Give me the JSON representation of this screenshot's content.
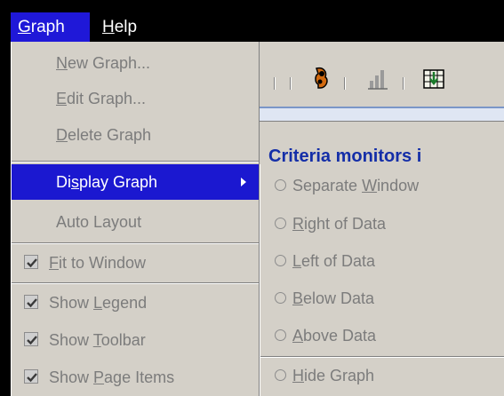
{
  "menubar": {
    "graph": {
      "pre": "",
      "key": "G",
      "post": "raph"
    },
    "help": {
      "pre": "",
      "key": "H",
      "post": "elp"
    }
  },
  "background": {
    "heading": "Criteria monitors i"
  },
  "graph_menu": {
    "new_graph": {
      "pre": "",
      "key": "N",
      "post": "ew Graph..."
    },
    "edit_graph": {
      "pre": "",
      "key": "E",
      "post": "dit Graph..."
    },
    "delete_graph": {
      "pre": "",
      "key": "D",
      "post": "elete Graph"
    },
    "display_graph": {
      "pre": "Di",
      "key": "s",
      "post": "play Graph"
    },
    "auto_layout": {
      "pre": "Auto Layout",
      "key": "",
      "post": ""
    },
    "fit_to_window": {
      "pre": "",
      "key": "F",
      "post": "it to Window",
      "checked": true
    },
    "show_legend": {
      "pre": "Show ",
      "key": "L",
      "post": "egend",
      "checked": true
    },
    "show_toolbar": {
      "pre": "Show ",
      "key": "T",
      "post": "oolbar",
      "checked": true
    },
    "show_page_items": {
      "pre": "Show ",
      "key": "P",
      "post": "age Items",
      "checked": true
    }
  },
  "display_submenu": {
    "separate_window": {
      "pre": "Separate ",
      "key": "W",
      "post": "indow"
    },
    "right_of_data": {
      "pre": "",
      "key": "R",
      "post": "ight of Data"
    },
    "left_of_data": {
      "pre": "",
      "key": "L",
      "post": "eft of Data"
    },
    "below_data": {
      "pre": "",
      "key": "B",
      "post": "elow Data"
    },
    "above_data": {
      "pre": "",
      "key": "A",
      "post": "bove Data"
    },
    "hide_graph": {
      "pre": "",
      "key": "H",
      "post": "ide Graph"
    }
  },
  "colors": {
    "menu_bg": "#d4d0c8",
    "highlight": "#1b18d0",
    "disabled_text": "#7c7c7c",
    "heading_blue": "#142ea8"
  }
}
